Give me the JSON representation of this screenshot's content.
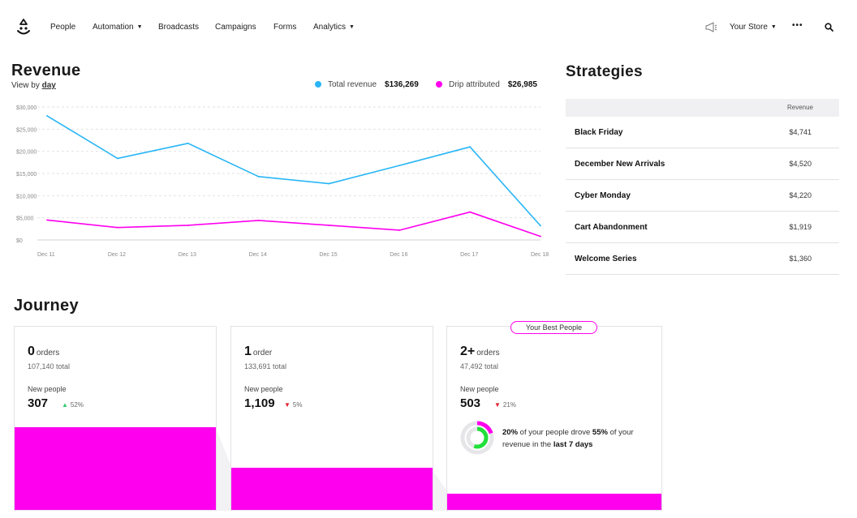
{
  "nav": {
    "items": [
      {
        "label": "People"
      },
      {
        "label": "Automation"
      },
      {
        "label": "Broadcasts"
      },
      {
        "label": "Campaigns"
      },
      {
        "label": "Forms"
      },
      {
        "label": "Analytics"
      }
    ],
    "store_label": "Your Store",
    "more_label": "•••"
  },
  "revenue": {
    "title": "Revenue",
    "view_by_prefix": "View by",
    "view_by_value": "day",
    "legend": [
      {
        "label": "Total revenue",
        "value": "$136,269",
        "color": "#29b6f6"
      },
      {
        "label": "Drip attributed",
        "value": "$26,985",
        "color": "#ff00ee"
      }
    ]
  },
  "chart_data": {
    "type": "line",
    "x": [
      "Dec 11",
      "Dec 12",
      "Dec 13",
      "Dec 14",
      "Dec 15",
      "Dec 16",
      "Dec 17",
      "Dec 18"
    ],
    "y_ticks": [
      "$0",
      "$5,000",
      "$10,000",
      "$15,000",
      "$20,000",
      "$25,000",
      "$30,000"
    ],
    "ylim": [
      0,
      30000
    ],
    "series": [
      {
        "name": "Total revenue",
        "color": "#29b6f6",
        "values": [
          28000,
          18400,
          21800,
          14300,
          12700,
          16800,
          21000,
          3200
        ]
      },
      {
        "name": "Drip attributed",
        "color": "#ff00ee",
        "values": [
          4500,
          2800,
          3300,
          4400,
          3300,
          2200,
          6300,
          800
        ]
      }
    ]
  },
  "strategies": {
    "title": "Strategies",
    "column_header": "Revenue",
    "rows": [
      {
        "name": "Black Friday",
        "revenue": "$4,741"
      },
      {
        "name": "December New Arrivals",
        "revenue": "$4,520"
      },
      {
        "name": "Cyber Monday",
        "revenue": "$4,220"
      },
      {
        "name": "Cart Abandonment",
        "revenue": "$1,919"
      },
      {
        "name": "Welcome Series",
        "revenue": "$1,360"
      }
    ]
  },
  "journey": {
    "title": "Journey",
    "cards": [
      {
        "count": "0",
        "unit": "orders",
        "total": "107,140 total",
        "new_people_label": "New people",
        "new_people": "307",
        "change": "52%",
        "direction": "up",
        "bar_fraction": 0.45
      },
      {
        "count": "1",
        "unit": "order",
        "total": "133,691 total",
        "new_people_label": "New people",
        "new_people": "1,109",
        "change": "5%",
        "direction": "down",
        "bar_fraction": 0.23
      },
      {
        "count": "2+",
        "unit": "orders",
        "total": "47,492 total",
        "new_people_label": "New people",
        "new_people": "503",
        "change": "21%",
        "direction": "down",
        "bar_fraction": 0.09
      }
    ],
    "best_badge": "Your Best People",
    "insight": {
      "pct_people": "20%",
      "text1": "of your people drove",
      "pct_revenue": "55%",
      "text2": "of your revenue in the",
      "period": "last 7 days"
    }
  }
}
